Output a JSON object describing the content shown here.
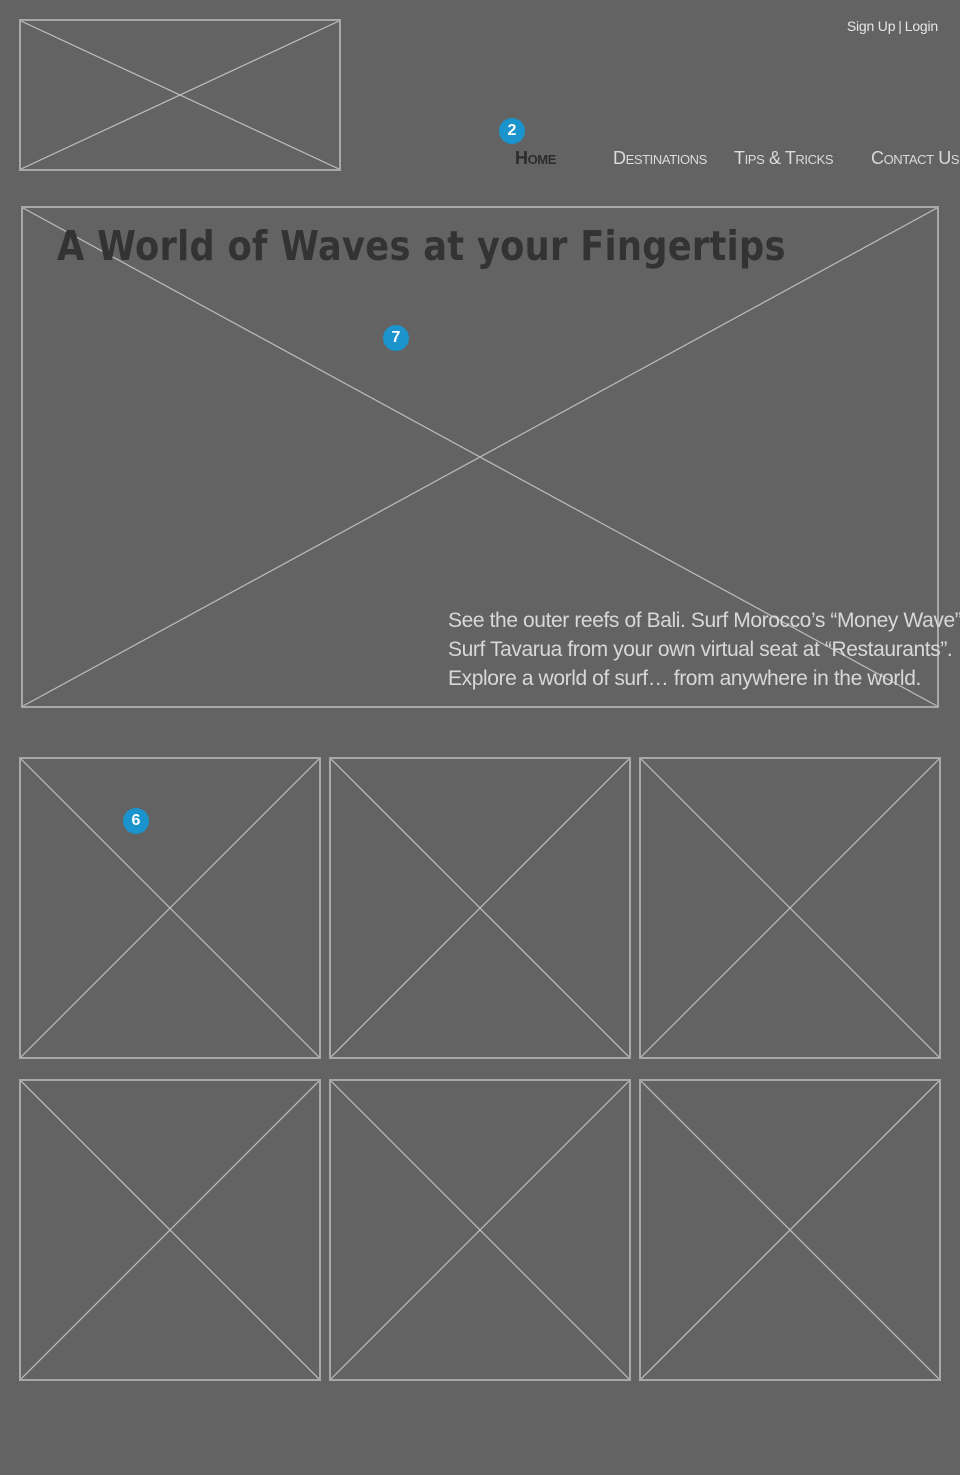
{
  "header": {
    "auth": {
      "signup_label": "Sign Up",
      "separator": "|",
      "login_label": "Login"
    }
  },
  "nav": {
    "items": [
      {
        "label": "Home",
        "active": true
      },
      {
        "label": "Destinations",
        "active": false
      },
      {
        "label": "Tips & Tricks",
        "active": false
      },
      {
        "label": "Contact Us",
        "active": false
      }
    ]
  },
  "hero": {
    "title": "A World of Waves at your Fingertips",
    "copy_lines": [
      "See the outer reefs of Bali. Surf Morocco’s “Money Wave”.",
      "Surf Tavarua from your own virtual seat at “Restaurants”.",
      "Explore a world of surf… from anywhere in the world."
    ]
  },
  "annotations": {
    "nav": "2",
    "hero": "7",
    "grid": "6"
  },
  "colors": {
    "background": "#636363",
    "placeholder_border": "#a8a8a8",
    "badge": "#1b93cc",
    "title": "#333333",
    "active_nav": "#2c2c2c"
  }
}
